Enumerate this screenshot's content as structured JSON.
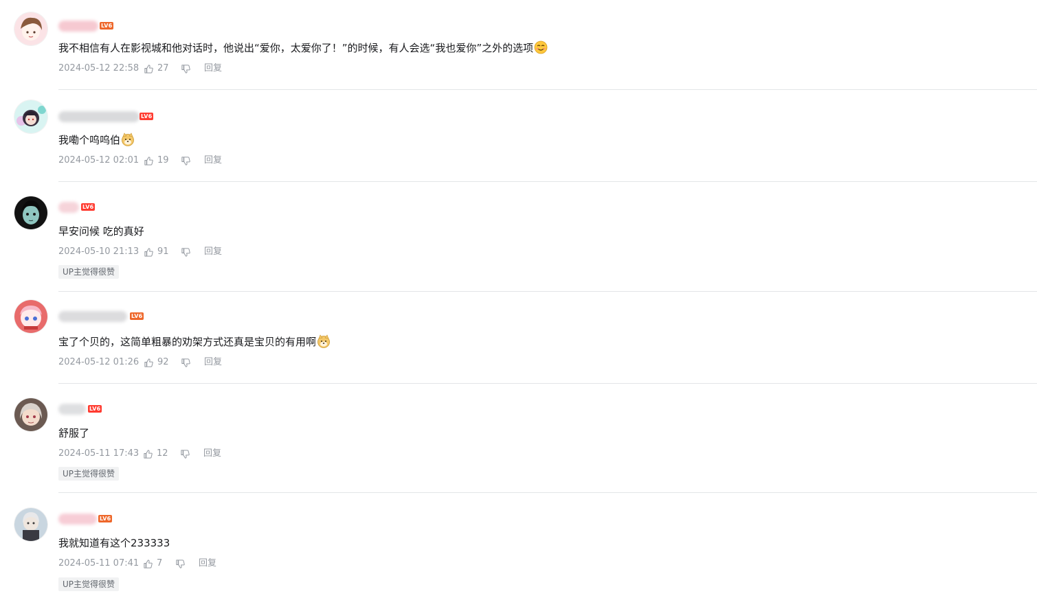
{
  "reply_label": "回复",
  "up_tag": "UP主觉得很赞",
  "level_badge": "LV6",
  "colors": {
    "text": "#18191c",
    "meta": "#9499a0",
    "divider": "#e3e5e7",
    "badge_lv6": "#ee672a",
    "badge_lv6_alt": "#ff3b30"
  },
  "comments": [
    {
      "content": "我不相信有人在影视城和他对话时，他说出“爱你，太爱你了！”的时候，有人会选“我也爱你”之外的选项",
      "emote": "shy-smile-emote",
      "time": "2024-05-12 22:58",
      "likes": "27"
    },
    {
      "content": "我嘞个呜呜伯",
      "emote": "doge-emote",
      "time": "2024-05-12 02:01",
      "likes": "19"
    },
    {
      "content": "早安问候 吃的真好",
      "time": "2024-05-10 21:13",
      "likes": "91",
      "up_liked": true
    },
    {
      "content": "宝了个贝的，这简单粗暴的劝架方式还真是宝贝的有用啊",
      "emote": "doge-emote",
      "time": "2024-05-12 01:26",
      "likes": "92"
    },
    {
      "content": "舒服了",
      "time": "2024-05-11 17:43",
      "likes": "12",
      "up_liked": true
    },
    {
      "content": "我就知道有这个233333",
      "time": "2024-05-11 07:41",
      "likes": "7",
      "up_liked": true
    }
  ]
}
